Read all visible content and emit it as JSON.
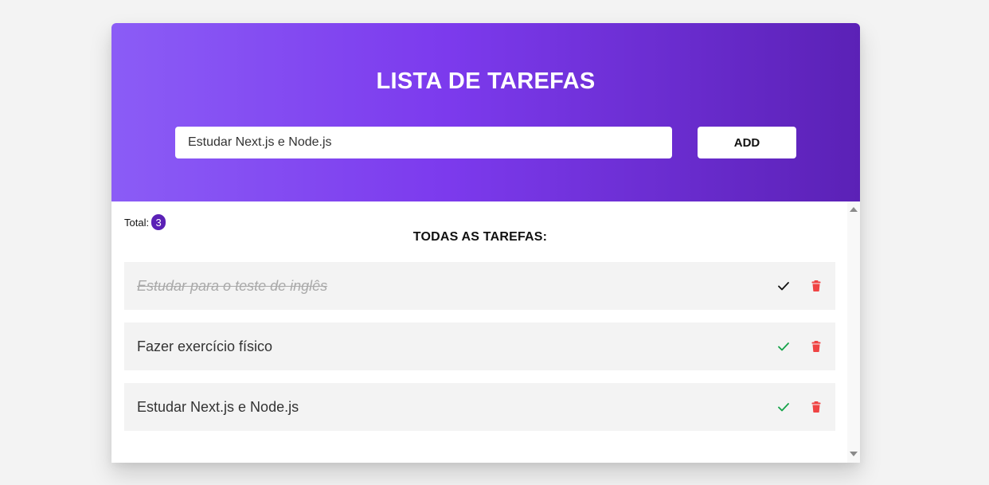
{
  "header": {
    "title": "LISTA DE TAREFAS"
  },
  "input": {
    "value": "Estudar Next.js e Node.js"
  },
  "add_button": {
    "label": "ADD"
  },
  "summary": {
    "total_label": "Total:",
    "total_count": "3"
  },
  "list": {
    "title": "TODAS AS TAREFAS:",
    "tasks": [
      {
        "text": "Estudar para o teste de inglês",
        "completed": true,
        "check_color": "#111111"
      },
      {
        "text": "Fazer exercício físico",
        "completed": false,
        "check_color": "#16a34a"
      },
      {
        "text": "Estudar Next.js e Node.js",
        "completed": false,
        "check_color": "#16a34a"
      }
    ]
  },
  "icons": {
    "complete": "check-icon",
    "delete": "trash-icon",
    "scroll_up": "scroll-up-arrow-icon",
    "scroll_down": "scroll-down-arrow-icon"
  },
  "colors": {
    "gradient_start": "#8b5cf6",
    "gradient_end": "#5b21b6",
    "badge": "#5b21b6",
    "delete": "#ef4444",
    "page_background": "#f3f3f3",
    "row_background": "#f3f3f3"
  }
}
